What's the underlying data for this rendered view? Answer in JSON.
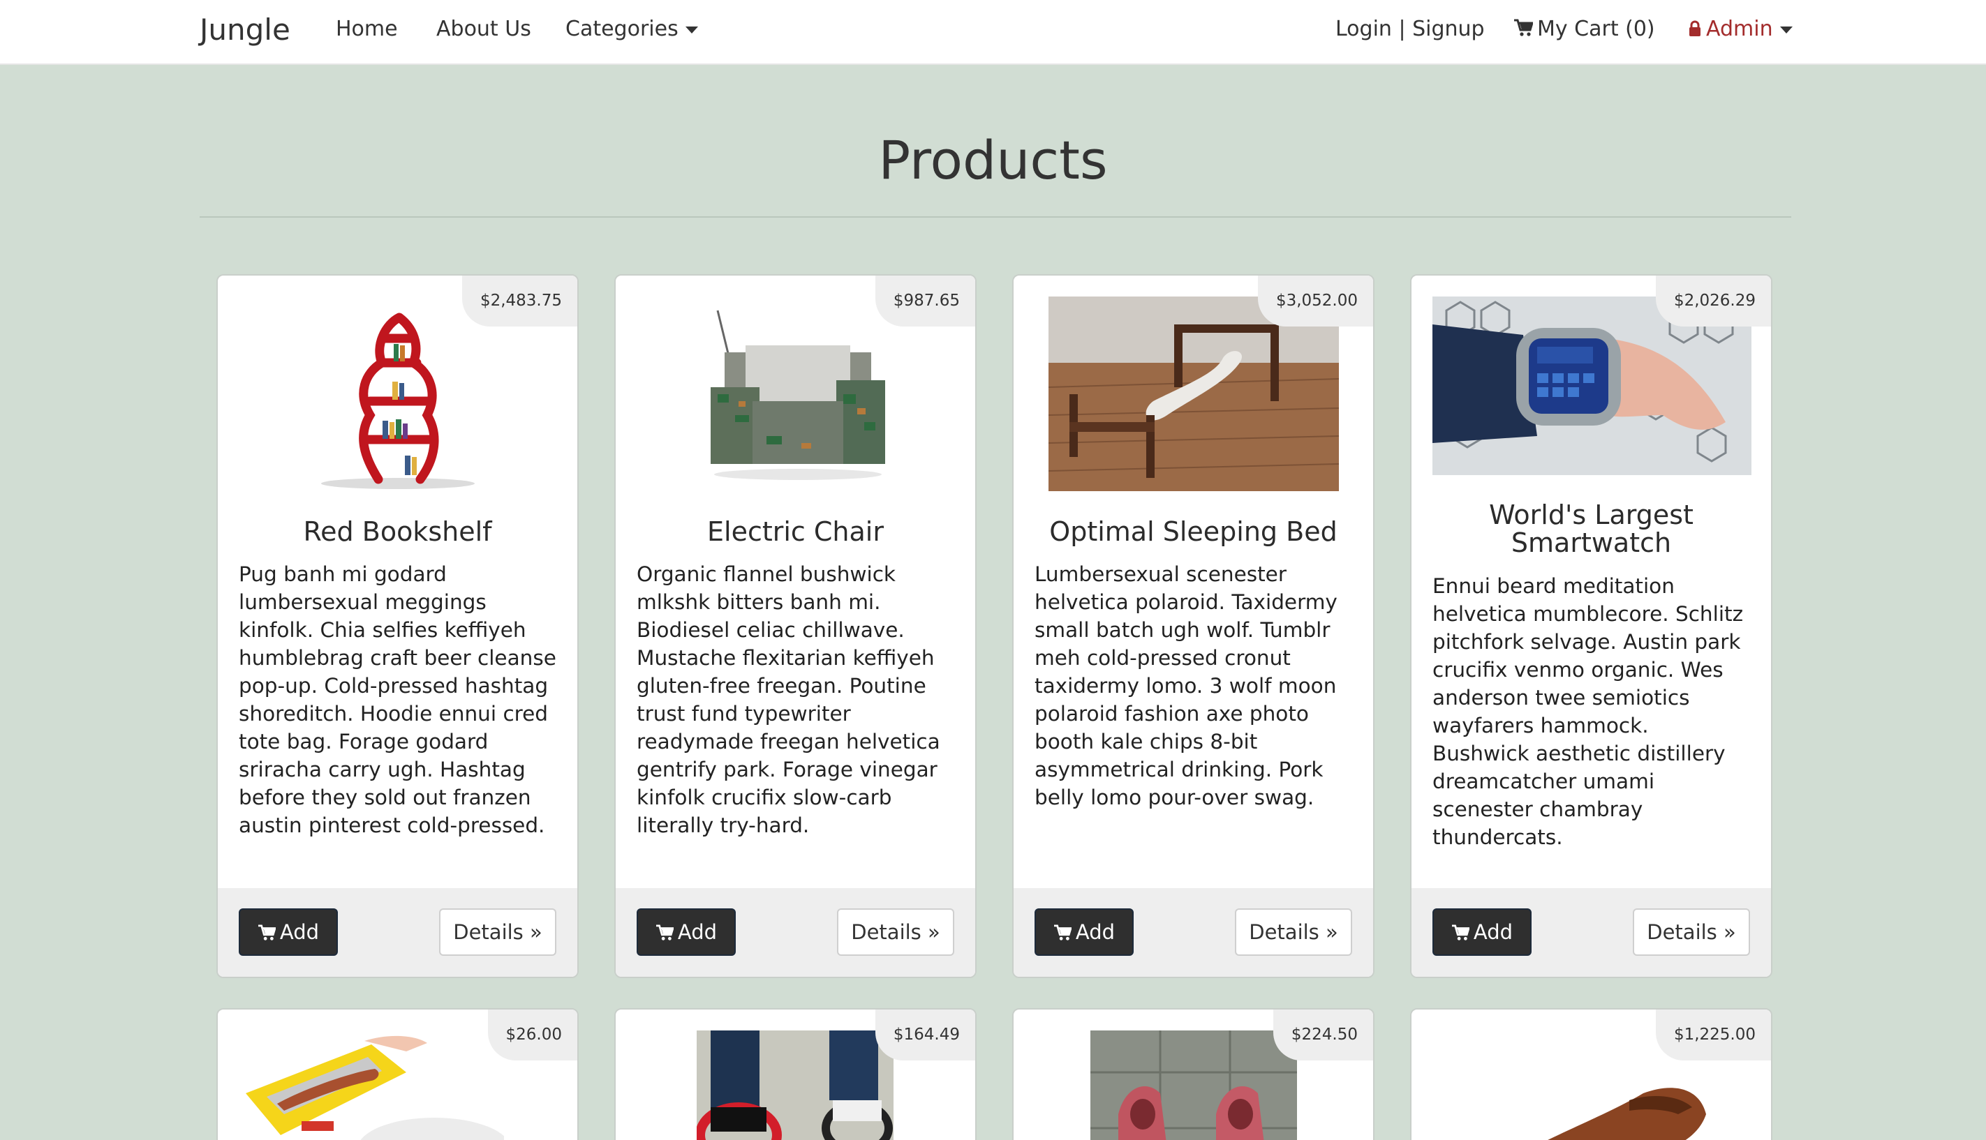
{
  "nav": {
    "brand": "Jungle",
    "home": "Home",
    "about": "About Us",
    "categories": "Categories",
    "login": "Login | Signup",
    "cart": "My Cart (0)",
    "admin": "Admin"
  },
  "page": {
    "title": "Products"
  },
  "buttons": {
    "add": "Add",
    "details": "Details »"
  },
  "products": [
    {
      "name": "Red Bookshelf",
      "price": "$2,483.75",
      "description": "Pug banh mi godard lumbersexual meggings kinfolk. Chia selfies keffiyeh humblebrag craft beer cleanse pop-up. Cold-pressed hashtag shoreditch. Hoodie ennui cred tote bag. Forage godard sriracha carry ugh. Hashtag before they sold out franzen austin pinterest cold-pressed."
    },
    {
      "name": "Electric Chair",
      "price": "$987.65",
      "description": "Organic flannel bushwick mlkshk bitters banh mi. Biodiesel celiac chillwave. Mustache flexitarian keffiyeh gluten-free freegan. Poutine trust fund typewriter readymade freegan helvetica gentrify park. Forage vinegar kinfolk crucifix slow-carb literally try-hard."
    },
    {
      "name": "Optimal Sleeping Bed",
      "price": "$3,052.00",
      "description": "Lumbersexual scenester helvetica polaroid. Taxidermy small batch ugh wolf. Tumblr meh cold-pressed cronut taxidermy lomo. 3 wolf moon polaroid fashion axe photo booth kale chips 8-bit asymmetrical drinking. Pork belly lomo pour-over swag."
    },
    {
      "name": "World's Largest Smartwatch",
      "price": "$2,026.29",
      "description": "Ennui beard meditation helvetica mumblecore. Schlitz pitchfork selvage. Austin park crucifix venmo organic. Wes anderson twee semiotics wayfarers hammock. Bushwick aesthetic distillery dreamcatcher umami scenester chambray thundercats."
    },
    {
      "price": "$26.00"
    },
    {
      "price": "$164.49"
    },
    {
      "price": "$224.50"
    },
    {
      "price": "$1,225.00"
    }
  ],
  "colors": {
    "background": "#d1ddd3",
    "admin_accent": "#a32c2c",
    "add_button": "#2f2f2f"
  }
}
